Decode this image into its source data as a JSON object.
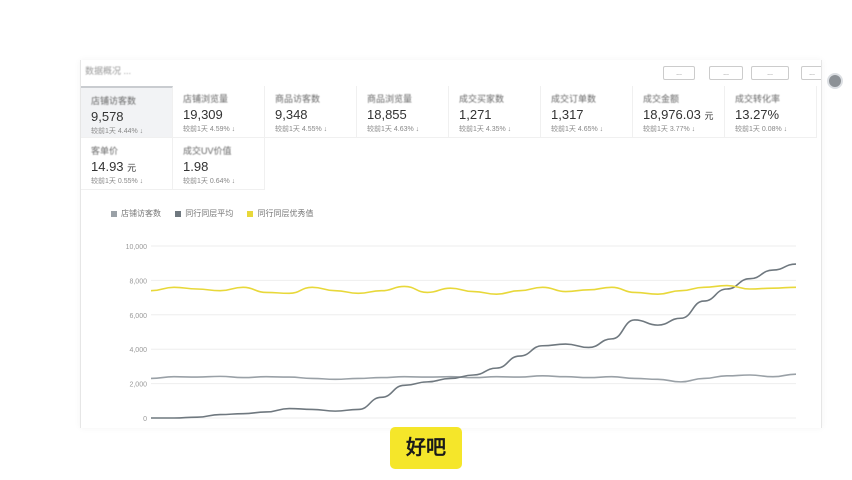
{
  "panel": {
    "title": "数据概况 ...",
    "toolbar": [
      "...",
      "...",
      "...",
      "..."
    ]
  },
  "metrics": [
    {
      "label": "店铺访客数",
      "value": "9,578",
      "unit": "",
      "compare_label": "较前1天",
      "change": "4.44%",
      "arrow": "↓",
      "active": true
    },
    {
      "label": "店铺浏览量",
      "value": "19,309",
      "unit": "",
      "compare_label": "较前1天",
      "change": "4.59%",
      "arrow": "↓",
      "active": false
    },
    {
      "label": "商品访客数",
      "value": "9,348",
      "unit": "",
      "compare_label": "较前1天",
      "change": "4.55%",
      "arrow": "↓",
      "active": false
    },
    {
      "label": "商品浏览量",
      "value": "18,855",
      "unit": "",
      "compare_label": "较前1天",
      "change": "4.63%",
      "arrow": "↓",
      "active": false
    },
    {
      "label": "成交买家数",
      "value": "1,271",
      "unit": "",
      "compare_label": "较前1天",
      "change": "4.35%",
      "arrow": "↓",
      "active": false
    },
    {
      "label": "成交订单数",
      "value": "1,317",
      "unit": "",
      "compare_label": "较前1天",
      "change": "4.65%",
      "arrow": "↓",
      "active": false
    },
    {
      "label": "成交金额",
      "value": "18,976.03",
      "unit": "元",
      "compare_label": "较前1天",
      "change": "3.77%",
      "arrow": "↓",
      "active": false
    },
    {
      "label": "成交转化率",
      "value": "13.27%",
      "unit": "",
      "compare_label": "较前1天",
      "change": "0.08%",
      "arrow": "↓",
      "active": false
    },
    {
      "label": "客单价",
      "value": "14.93",
      "unit": "元",
      "compare_label": "较前1天",
      "change": "0.55%",
      "arrow": "↓",
      "active": false
    },
    {
      "label": "成交UV价值",
      "value": "1.98",
      "unit": "",
      "compare_label": "较前1天",
      "change": "0.64%",
      "arrow": "↓",
      "active": false
    }
  ],
  "colors": {
    "series_a": "#9aa1a7",
    "series_b": "#6f787f",
    "series_c": "#e8d83a",
    "grid": "#eeeeee",
    "subtitle_bg": "#f5e62a"
  },
  "chart_data": {
    "type": "line",
    "ylim": [
      0,
      10000
    ],
    "y_ticks": [
      "0",
      "2,000",
      "4,000",
      "6,000",
      "8,000",
      "10,000"
    ],
    "y_tick_values": [
      0,
      2000,
      4000,
      6000,
      8000,
      10000
    ],
    "x": [
      0,
      1,
      2,
      3,
      4,
      5,
      6,
      7,
      8,
      9,
      10,
      11,
      12,
      13,
      14,
      15,
      16,
      17,
      18,
      19,
      20,
      21,
      22,
      23,
      24,
      25,
      26,
      27,
      28
    ],
    "series": [
      {
        "name": "店铺访客数",
        "values": [
          2300,
          2400,
          2380,
          2420,
          2350,
          2400,
          2380,
          2300,
          2250,
          2300,
          2350,
          2400,
          2380,
          2400,
          2350,
          2400,
          2380,
          2450,
          2400,
          2350,
          2400,
          2300,
          2250,
          2100,
          2300,
          2450,
          2500,
          2400,
          2550
        ]
      },
      {
        "name": "同行同层平均",
        "values": [
          0,
          0,
          50,
          200,
          250,
          350,
          550,
          500,
          400,
          500,
          1200,
          1900,
          2100,
          2300,
          2500,
          2900,
          3600,
          4200,
          4300,
          4100,
          4600,
          5700,
          5400,
          5800,
          6800,
          7500,
          8100,
          8600,
          8950
        ]
      },
      {
        "name": "同行同层优秀值",
        "values": [
          7400,
          7600,
          7500,
          7400,
          7600,
          7300,
          7250,
          7600,
          7400,
          7250,
          7400,
          7650,
          7300,
          7550,
          7350,
          7200,
          7400,
          7600,
          7350,
          7450,
          7600,
          7300,
          7200,
          7400,
          7600,
          7700,
          7500,
          7550,
          7600
        ]
      }
    ]
  },
  "subtitle": "好吧"
}
